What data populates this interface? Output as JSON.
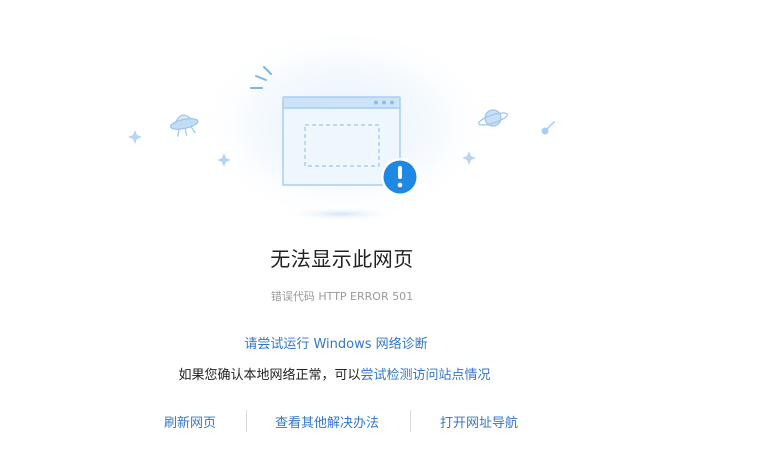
{
  "error": {
    "title": "无法显示此网页",
    "code_text": "错误代码 HTTP ERROR 501"
  },
  "help": {
    "diagnose_link": "请尝试运行 Windows 网络诊断",
    "check_prefix": "如果您确认本地网络正常，可以",
    "check_link": "尝试检测访问站点情况"
  },
  "actions": {
    "refresh": "刷新网页",
    "other_solutions": "查看其他解决办法",
    "open_nav": "打开网址导航"
  },
  "colors": {
    "link": "#3377c8",
    "alert_badge": "#1e88e5",
    "illustration": "#a9cef2"
  },
  "icons": {
    "main": "browser-window-icon",
    "badge": "alert-exclamation-icon",
    "decor": [
      "ufo-icon",
      "planet-icon",
      "comet-icon",
      "sparkle-icon"
    ]
  }
}
